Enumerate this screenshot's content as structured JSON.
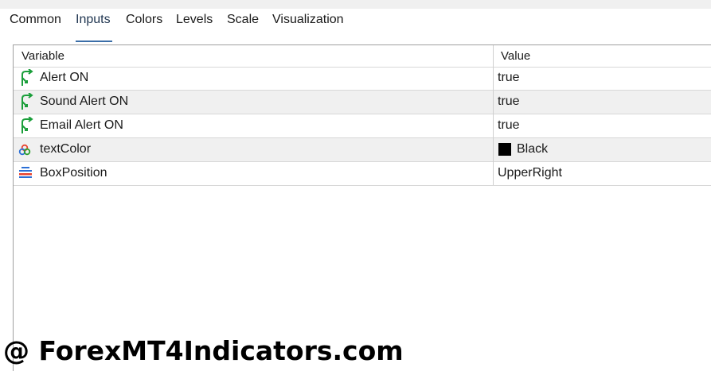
{
  "tabs": [
    {
      "label": "Common",
      "active": false
    },
    {
      "label": "Inputs",
      "active": true
    },
    {
      "label": "Colors",
      "active": false
    },
    {
      "label": "Levels",
      "active": false
    },
    {
      "label": "Scale",
      "active": false
    },
    {
      "label": "Visualization",
      "active": false
    }
  ],
  "table": {
    "columns": [
      "Variable",
      "Value"
    ],
    "rows": [
      {
        "icon": "bool-variable-icon",
        "name": "Alert ON",
        "value": "true"
      },
      {
        "icon": "bool-variable-icon",
        "name": "Sound Alert ON",
        "value": "true"
      },
      {
        "icon": "bool-variable-icon",
        "name": "Email Alert ON",
        "value": "true"
      },
      {
        "icon": "color-variable-icon",
        "name": "textColor",
        "value": "Black",
        "swatch_color": "#000000"
      },
      {
        "icon": "enum-variable-icon",
        "name": "BoxPosition",
        "value": "UpperRight"
      }
    ]
  },
  "watermark": "@ ForexMT4Indicators.com",
  "colors": {
    "accent": "#3b6ea8",
    "bool_icon": "#1a9e3a",
    "alt_row": "#f0f0f0"
  }
}
